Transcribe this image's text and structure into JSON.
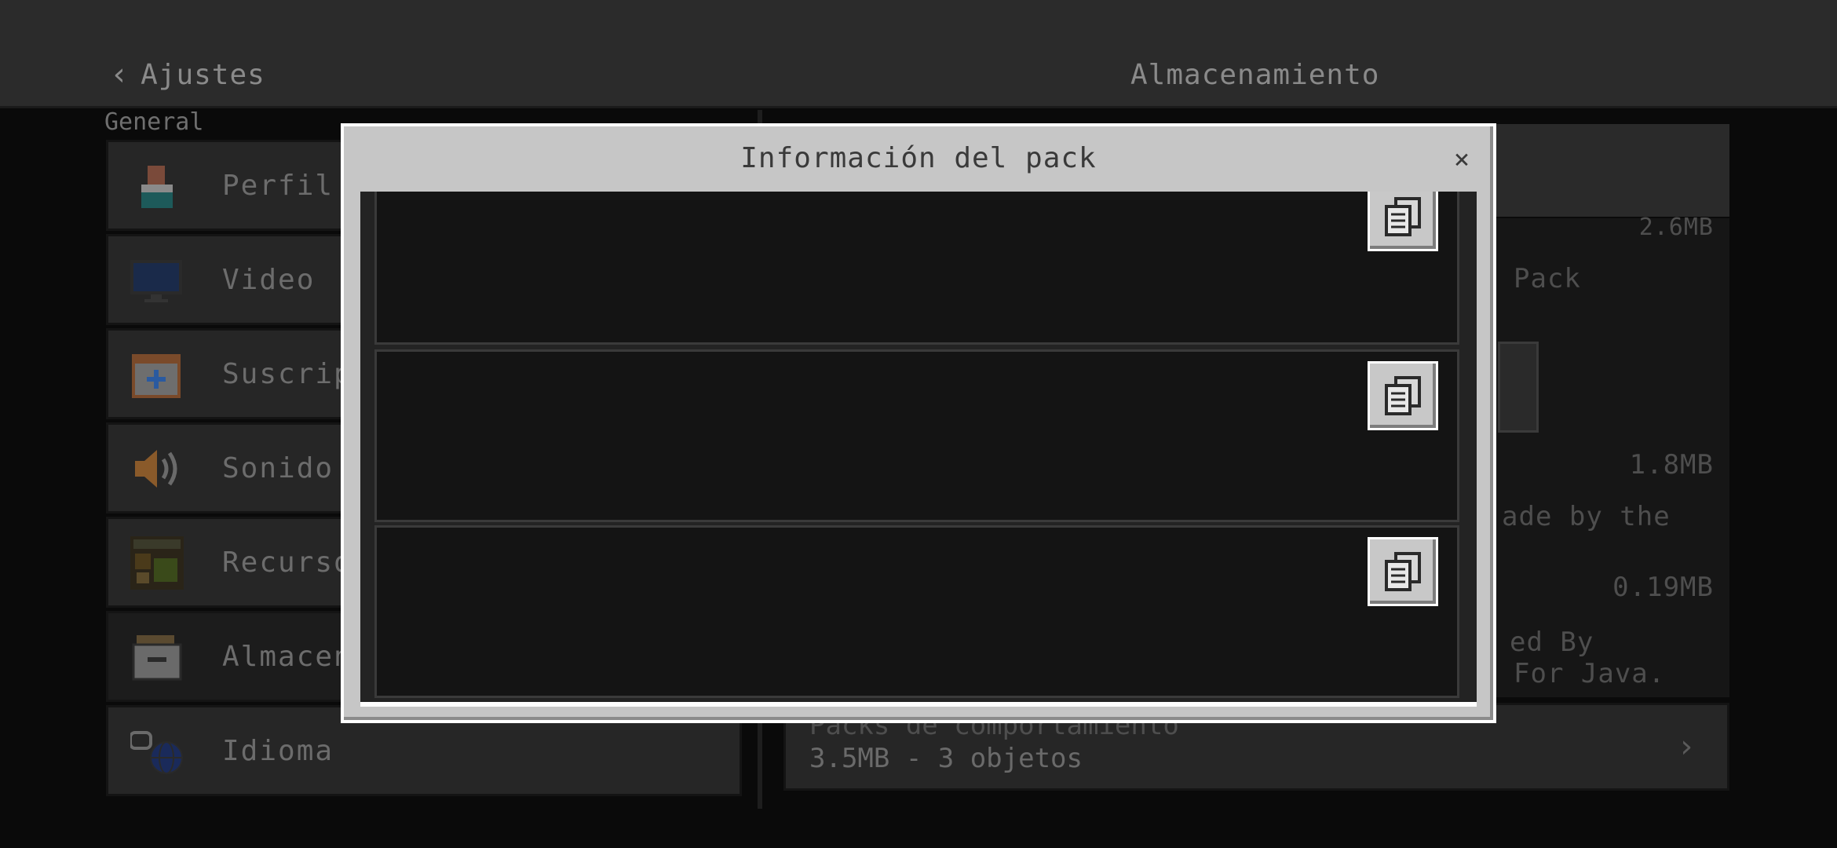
{
  "header": {
    "back_label": "Ajustes",
    "title": "Almacenamiento"
  },
  "sidebar": {
    "section": "General",
    "items": [
      {
        "label": "Perfil",
        "icon": "profile-icon"
      },
      {
        "label": "Video",
        "icon": "monitor-icon"
      },
      {
        "label": "Suscrip",
        "icon": "calendar-plus-icon"
      },
      {
        "label": "Sonido",
        "icon": "speaker-icon"
      },
      {
        "label": "Recurso",
        "icon": "resource-pack-icon"
      },
      {
        "label": "Almacen",
        "icon": "storage-icon"
      },
      {
        "label": "Idioma",
        "icon": "language-globe-icon"
      }
    ]
  },
  "right_panel": {
    "size_1": "2.6MB",
    "pack_text": "Pack",
    "size_2": "1.8MB",
    "desc_1": "ade by the",
    "size_3": "0.19MB",
    "desc_2a": "ed By",
    "desc_2b": "For Java.",
    "behavior_title": "Packs de comportamiento",
    "behavior_sub": "3.5MB - 3 objetos"
  },
  "dialog": {
    "title": "Información del pack",
    "close": "×",
    "copy_icon": "copy-icon"
  },
  "colors": {
    "dialog_bg": "#c6c6c6",
    "dialog_body": "#232323",
    "card_bg": "#141414",
    "topbar": "#2b2b2b"
  }
}
